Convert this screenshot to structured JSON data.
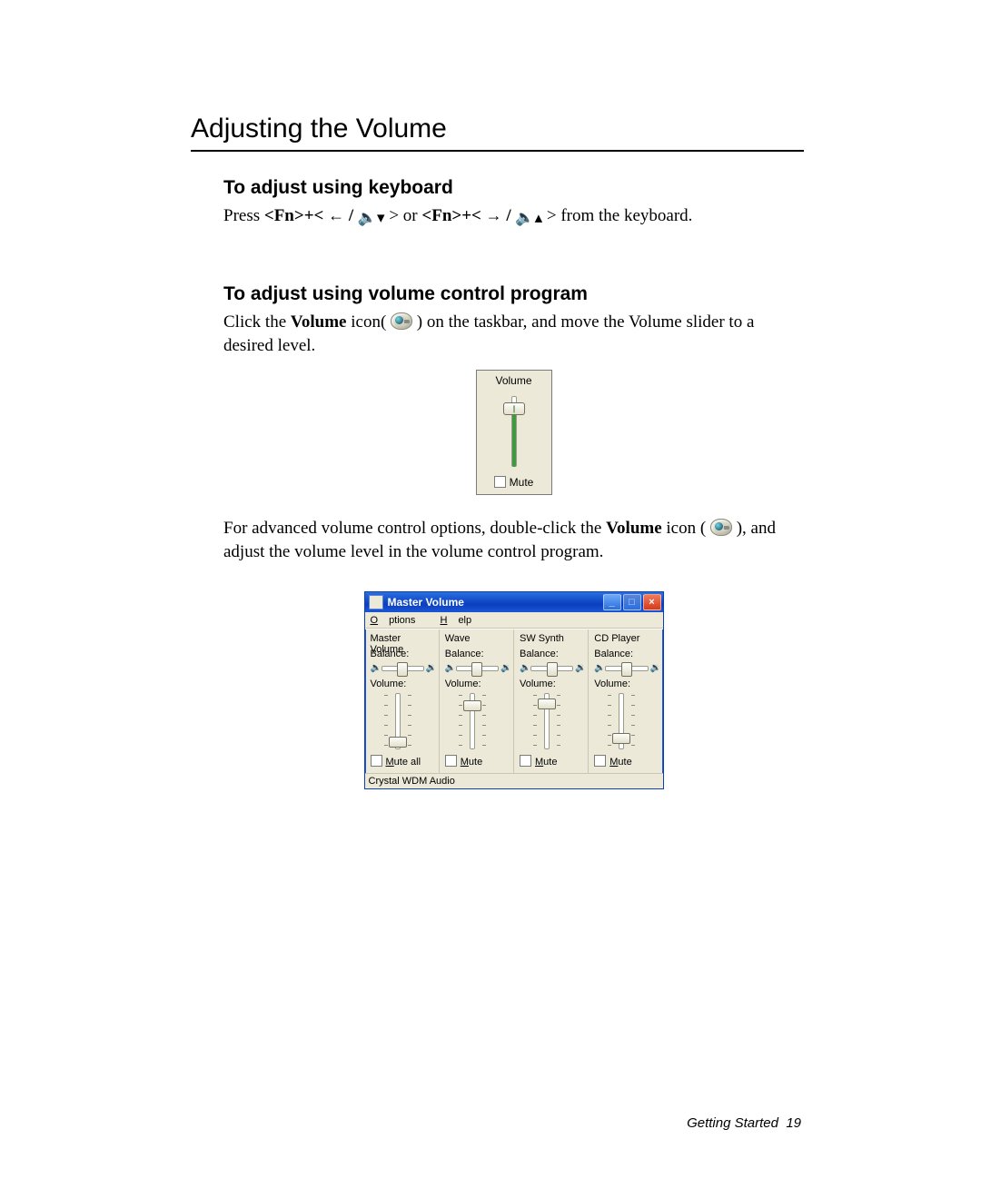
{
  "page": {
    "title": "Adjusting the Volume",
    "footer_section": "Getting Started",
    "footer_page": "19"
  },
  "section1": {
    "heading": "To adjust using keyboard",
    "press_prefix": "Press ",
    "fn1": "<Fn>+<",
    "mid_or": " > or ",
    "fn2": "<Fn>+<",
    "end": " > from the keyboard."
  },
  "section2": {
    "heading": "To adjust using volume control program",
    "p1_a": "Click the ",
    "p1_b": "Volume",
    "p1_c": " icon(",
    "p1_d": ") on the taskbar, and move the Volume slider to a desired level.",
    "p2_a": "For advanced volume control options, double-click the ",
    "p2_b": "Volume",
    "p2_c": " icon (",
    "p2_d": "), and adjust the volume level in the volume control program."
  },
  "popup": {
    "title": "Volume",
    "mute": "Mute",
    "slider_pct": 85
  },
  "master_volume": {
    "window_title": "Master Volume",
    "menu": {
      "options": "Options",
      "help": "Help"
    },
    "status": "Crystal WDM Audio",
    "labels": {
      "balance": "Balance:",
      "volume": "Volume:"
    },
    "mute_all": "Mute all",
    "mute": "Mute",
    "channels": [
      {
        "name": "Master Volume",
        "balance_pct": 50,
        "volume_pct": 10,
        "mute_label": "Mute all"
      },
      {
        "name": "Wave",
        "balance_pct": 50,
        "volume_pct": 85,
        "mute_label": "Mute"
      },
      {
        "name": "SW Synth",
        "balance_pct": 50,
        "volume_pct": 88,
        "mute_label": "Mute"
      },
      {
        "name": "CD Player",
        "balance_pct": 50,
        "volume_pct": 18,
        "mute_label": "Mute"
      }
    ]
  }
}
